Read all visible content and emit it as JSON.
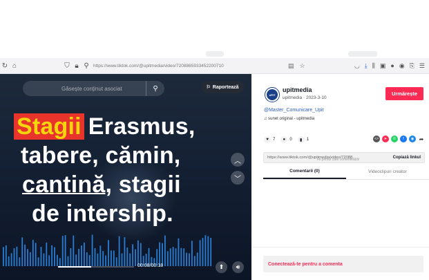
{
  "browser": {
    "url": "https://www.tiktok.com/@upitmedia/video/7208865933452200710",
    "nav_icons": [
      "refresh-icon",
      "home-icon"
    ],
    "toolbar_icons": [
      "pocket-icon",
      "download-icon",
      "library-icon",
      "reader-icon",
      "extension-icon",
      "account-icon",
      "bookmark-icon",
      "menu-icon"
    ]
  },
  "video": {
    "search_placeholder": "Găsește conținut asociat",
    "report_label": "Raportează",
    "caption": {
      "highlight": "Stagii",
      "line1_rest": "Erasmus,",
      "line2": "tabere, cămin,",
      "line3_underlined": "cantină",
      "line3_rest": ", stagii",
      "line4": "de intership."
    },
    "time": "00:08/00:18",
    "progress": 0.44,
    "highlight_bg": "#e8342a",
    "highlight_fg": "#f5d60c"
  },
  "author": {
    "name": "upitmedia",
    "meta": "upitmedia · 2023-3-10",
    "avatar_text": "UPIT",
    "follow_label": "Urmărește",
    "hashtag": "@Master_Comunicare_Upit",
    "sound": "sunet original - upitmedia"
  },
  "stats": {
    "likes": "7",
    "comments": "0",
    "saves": "1"
  },
  "share": {
    "link": "https://www.tiktok.com/@upitmedia/video/72088...",
    "copy_label": "Copiază linkul",
    "ghost_text": "Fii primul care comentează!"
  },
  "tabs": {
    "comments": "Comentarii (0)",
    "creator_videos": "Videoclipuri creator"
  },
  "login_prompt": "Conectează-te pentru a comenta",
  "colors": {
    "accent": "#fe2c55",
    "link": "#2b5db8"
  }
}
